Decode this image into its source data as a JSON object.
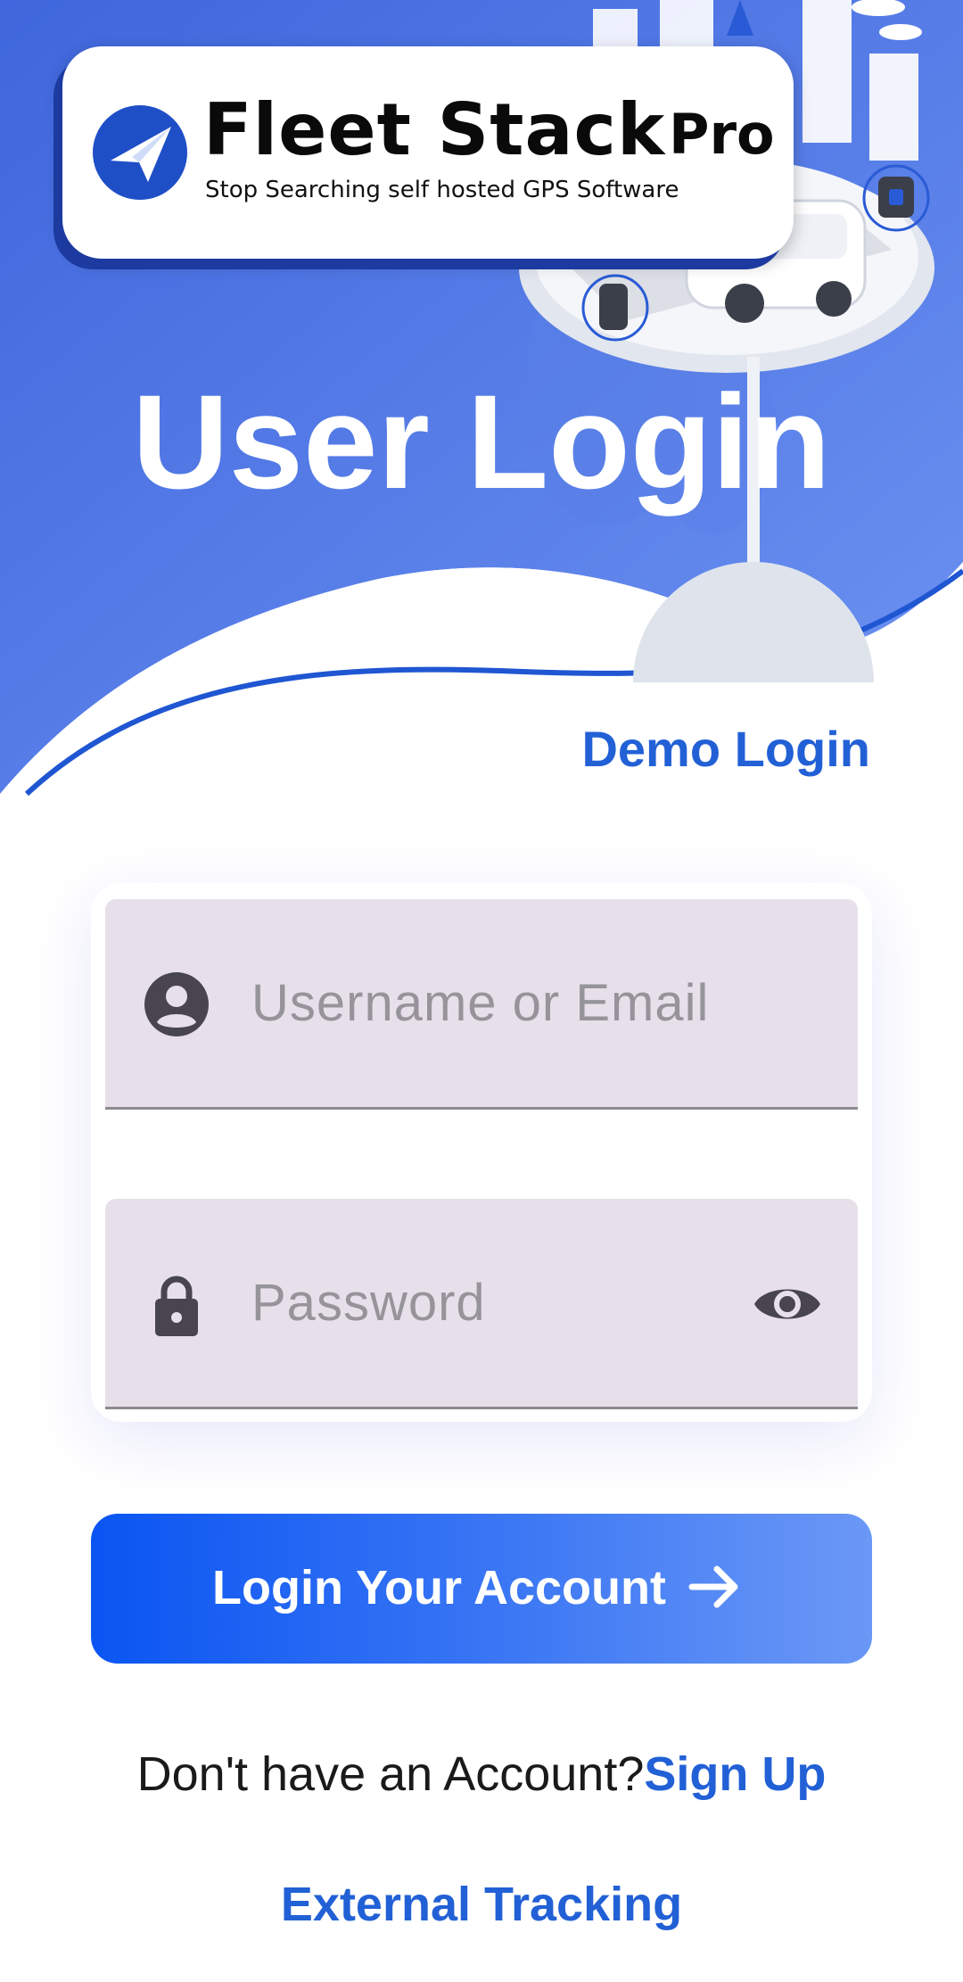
{
  "logo": {
    "title": "Fleet Stack",
    "suffix": "Pro",
    "tagline": "Stop Searching self hosted GPS Software"
  },
  "page_title": "User Login",
  "demo_login": "Demo Login",
  "form": {
    "username": {
      "placeholder": "Username or Email",
      "icon": "account-circle-icon"
    },
    "password": {
      "placeholder": "Password",
      "icon": "lock-icon",
      "toggle_icon": "eye-icon"
    }
  },
  "login_button": {
    "label": "Login Your Account",
    "icon": "arrow-right-icon"
  },
  "signup": {
    "question": "Don't have an Account?",
    "link": "Sign Up"
  },
  "external_tracking": "External Tracking",
  "colors": {
    "hero_blue": "#4a74e4",
    "link_blue": "#2260d6",
    "field_bg": "#e7e0ea",
    "button_start": "#0a55f2",
    "button_end": "#6b98f6"
  }
}
